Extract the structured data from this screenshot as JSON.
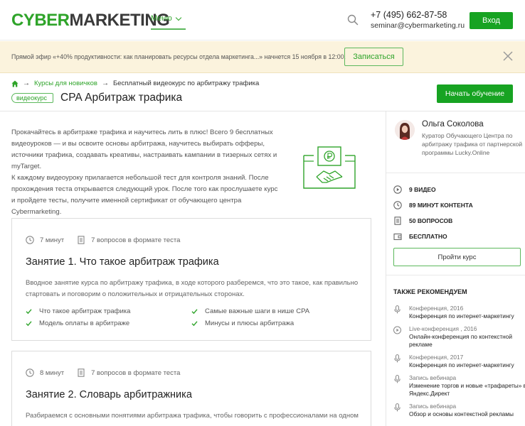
{
  "header": {
    "logo_green": "CYBER",
    "logo_dark": "MARKETING",
    "menu_label": "Меню",
    "phone": "+7 (495) 662-87-58",
    "email": "seminar@cybermarketing.ru",
    "login_label": "Вход"
  },
  "banner": {
    "text": "Прямой эфир «+40% продуктивности: как планировать ресурсы отдела маркетинга...» начнется 15 ноября в 12:00.",
    "button_label": "Записаться"
  },
  "breadcrumb": {
    "items": [
      "Курсы для новичков",
      "Бесплатный видеокурс по арбитражу трафика"
    ],
    "separator": "→"
  },
  "course": {
    "tag": "видеокурс",
    "title": "CPA Арбитраж трафика",
    "start_label": "Начать обучение",
    "intro_p1": "Прокачайтесь в арбитраже трафика и научитесь лить в плюс! Всего 9 бесплатных видеоуроков — и вы освоите основы арбитража, научитесь выбирать офферы, источники трафика, создавать креативы, настраивать кампании в тизерных сетях и myTarget.",
    "intro_p2": "К каждому видеоуроку прилагается небольшой тест для контроля знаний. После прохождения теста открывается следующий урок. После того как прослушаете курс и пройдете тесты, получите именной сертификат от обучающего центра Cybermarketing."
  },
  "lessons": [
    {
      "duration": "7 минут",
      "questions": "7 вопросов в формате теста",
      "title": "Занятие 1. Что такое арбитраж трафика",
      "desc": "Вводное занятие курса по арбитражу трафика, в ходе которого разберемся, что это такое, как правильно стартовать и поговорим о положительных и отрицательных сторонах.",
      "checks": [
        "Что такое арбитраж трафика",
        "Самые важные шаги в нише CPA",
        "Модель оплаты в арбитраже",
        "Минусы и плюсы арбитража"
      ]
    },
    {
      "duration": "8 минут",
      "questions": "7 вопросов в формате теста",
      "title": "Занятие 2. Словарь арбитражника",
      "desc": "Разбираемся с основными понятиями арбитража трафика, чтобы говорить с профессионалами на одном"
    }
  ],
  "sidebar": {
    "author_name": "Ольга Соколова",
    "author_role": "Куратор Обучающего Центра по арбитражу трафика от партнерской программы Lucky.Online",
    "stats": [
      {
        "icon": "play-icon",
        "label": "9 видео"
      },
      {
        "icon": "clock-icon",
        "label": "89 минут контента"
      },
      {
        "icon": "document-icon",
        "label": "50 вопросов"
      },
      {
        "icon": "wallet-icon",
        "label": "Бесплатно"
      }
    ],
    "take_label": "Пройти курс",
    "rec_title": "Также рекомендуем",
    "recommendations": [
      {
        "icon": "microphone-icon",
        "type": "Конференция, 2016",
        "name": "Конференция по интернет-маркетингу"
      },
      {
        "icon": "play-icon",
        "type": "Live-конференция , 2016",
        "name": "Онлайн-конференция по контекстной рекламе"
      },
      {
        "icon": "microphone-icon",
        "type": "Конференция, 2017",
        "name": "Конференция по интернет-маркетингу"
      },
      {
        "icon": "microphone-icon",
        "type": "Запись вебинара",
        "name": "Изменение торгов и новые «трафареты» в Яндекс.Директ"
      },
      {
        "icon": "microphone-icon",
        "type": "Запись вебинара",
        "name": "Обзор и основы контекстной рекламы"
      }
    ]
  },
  "colors": {
    "brand_green": "#17a322",
    "link_green": "#2fa42a",
    "banner_bg": "#fbf3dd"
  }
}
